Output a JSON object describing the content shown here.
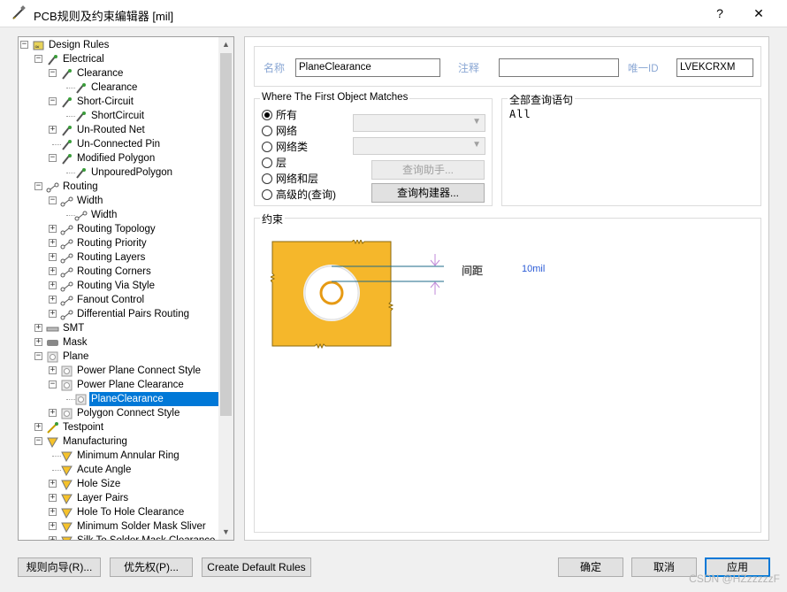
{
  "window": {
    "title": "PCB规则及约束编辑器 [mil]",
    "help": "?",
    "close": "✕"
  },
  "tree": {
    "rows": [
      {
        "label": "Design Rules",
        "level": 0,
        "exp": "−",
        "icon": "design-rules-icon"
      },
      {
        "label": "Electrical",
        "level": 1,
        "exp": "−",
        "icon": "electrical-icon"
      },
      {
        "label": "Clearance",
        "level": 2,
        "exp": "−",
        "icon": "rule-icon"
      },
      {
        "label": "Clearance",
        "level": 3,
        "exp": "",
        "icon": "rule-icon"
      },
      {
        "label": "Short-Circuit",
        "level": 2,
        "exp": "−",
        "icon": "rule-icon"
      },
      {
        "label": "ShortCircuit",
        "level": 3,
        "exp": "",
        "icon": "rule-icon"
      },
      {
        "label": "Un-Routed Net",
        "level": 2,
        "exp": "+",
        "icon": "rule-icon"
      },
      {
        "label": "Un-Connected Pin",
        "level": 2,
        "exp": "",
        "icon": "rule-icon"
      },
      {
        "label": "Modified Polygon",
        "level": 2,
        "exp": "−",
        "icon": "rule-icon"
      },
      {
        "label": "UnpouredPolygon",
        "level": 3,
        "exp": "",
        "icon": "rule-icon"
      },
      {
        "label": "Routing",
        "level": 1,
        "exp": "−",
        "icon": "routing-icon"
      },
      {
        "label": "Width",
        "level": 2,
        "exp": "−",
        "icon": "routing-icon"
      },
      {
        "label": "Width",
        "level": 3,
        "exp": "",
        "icon": "routing-icon"
      },
      {
        "label": "Routing Topology",
        "level": 2,
        "exp": "+",
        "icon": "routing-icon"
      },
      {
        "label": "Routing Priority",
        "level": 2,
        "exp": "+",
        "icon": "routing-icon"
      },
      {
        "label": "Routing Layers",
        "level": 2,
        "exp": "+",
        "icon": "routing-icon"
      },
      {
        "label": "Routing Corners",
        "level": 2,
        "exp": "+",
        "icon": "routing-icon"
      },
      {
        "label": "Routing Via Style",
        "level": 2,
        "exp": "+",
        "icon": "routing-icon"
      },
      {
        "label": "Fanout Control",
        "level": 2,
        "exp": "+",
        "icon": "routing-icon"
      },
      {
        "label": "Differential Pairs Routing",
        "level": 2,
        "exp": "+",
        "icon": "routing-icon"
      },
      {
        "label": "SMT",
        "level": 1,
        "exp": "+",
        "icon": "smt-icon"
      },
      {
        "label": "Mask",
        "level": 1,
        "exp": "+",
        "icon": "mask-icon"
      },
      {
        "label": "Plane",
        "level": 1,
        "exp": "−",
        "icon": "plane-icon"
      },
      {
        "label": "Power Plane Connect Style",
        "level": 2,
        "exp": "+",
        "icon": "plane-icon"
      },
      {
        "label": "Power Plane Clearance",
        "level": 2,
        "exp": "−",
        "icon": "plane-icon"
      },
      {
        "label": "PlaneClearance",
        "level": 3,
        "exp": "",
        "icon": "plane-icon",
        "selected": true
      },
      {
        "label": "Polygon Connect Style",
        "level": 2,
        "exp": "+",
        "icon": "plane-icon"
      },
      {
        "label": "Testpoint",
        "level": 1,
        "exp": "+",
        "icon": "testpoint-icon"
      },
      {
        "label": "Manufacturing",
        "level": 1,
        "exp": "−",
        "icon": "manufacturing-icon"
      },
      {
        "label": "Minimum Annular Ring",
        "level": 2,
        "exp": "",
        "icon": "manufacturing-icon"
      },
      {
        "label": "Acute Angle",
        "level": 2,
        "exp": "",
        "icon": "manufacturing-icon"
      },
      {
        "label": "Hole Size",
        "level": 2,
        "exp": "+",
        "icon": "manufacturing-icon"
      },
      {
        "label": "Layer Pairs",
        "level": 2,
        "exp": "+",
        "icon": "manufacturing-icon"
      },
      {
        "label": "Hole To Hole Clearance",
        "level": 2,
        "exp": "+",
        "icon": "manufacturing-icon"
      },
      {
        "label": "Minimum Solder Mask Sliver",
        "level": 2,
        "exp": "+",
        "icon": "manufacturing-icon"
      },
      {
        "label": "Silk To Solder Mask Clearance",
        "level": 2,
        "exp": "+",
        "icon": "manufacturing-icon"
      }
    ]
  },
  "rule": {
    "name_label": "名称",
    "name_value": "PlaneClearance",
    "comment_label": "注释",
    "comment_value": "",
    "id_label": "唯一ID",
    "id_value": "LVEKCRXM"
  },
  "match": {
    "title": "Where The First Object Matches",
    "options": [
      {
        "label": "所有",
        "checked": true
      },
      {
        "label": "网络",
        "checked": false
      },
      {
        "label": "网络类",
        "checked": false
      },
      {
        "label": "层",
        "checked": false
      },
      {
        "label": "网络和层",
        "checked": false
      },
      {
        "label": "高级的(查询)",
        "checked": false
      }
    ],
    "query_helper": "查询助手...",
    "query_builder": "查询构建器..."
  },
  "query": {
    "title": "全部查询语句",
    "text": "All"
  },
  "constraints": {
    "title": "约束",
    "clearance_label": "间距",
    "clearance_value": "10mil"
  },
  "footer": {
    "rule_wizard": "规则向导(R)...",
    "priorities": "优先权(P)...",
    "create_default": "Create Default Rules",
    "ok": "确定",
    "cancel": "取消",
    "apply": "应用"
  },
  "watermark": "CSDN @HZzzzzzF",
  "colors": {
    "copper": "#f5b72b",
    "selection": "#0078d7",
    "annotation": "#c08ad8"
  }
}
